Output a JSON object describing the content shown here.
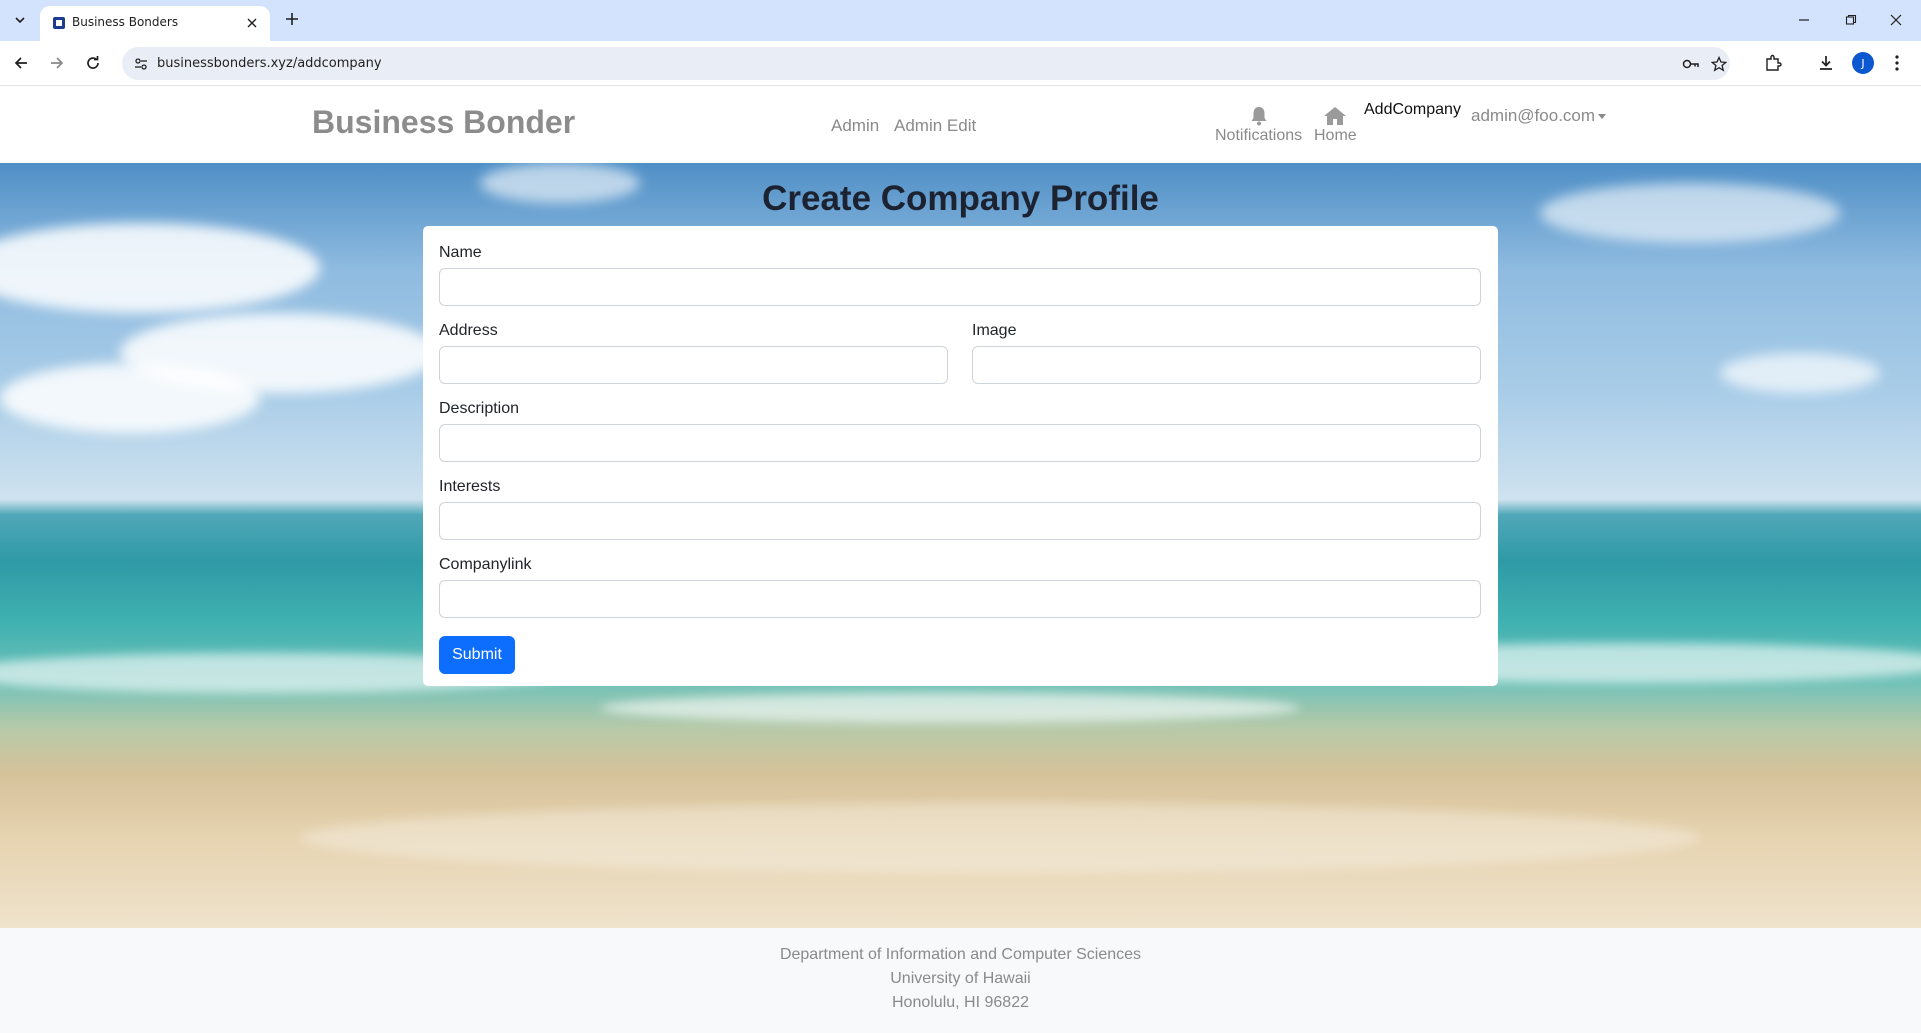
{
  "browser": {
    "tab_title": "Business Bonders",
    "url": "businessbonders.xyz/addcompany",
    "profile_initial": "J"
  },
  "nav": {
    "brand": "Business Bonder",
    "links": [
      "Admin",
      "Admin Edit"
    ],
    "notifications_label": "Notifications",
    "home_label": "Home",
    "active_label": "AddCompany",
    "user_email": "admin@foo.com"
  },
  "form": {
    "title": "Create Company Profile",
    "fields": {
      "name": {
        "label": "Name",
        "value": ""
      },
      "address": {
        "label": "Address",
        "value": ""
      },
      "image": {
        "label": "Image",
        "value": ""
      },
      "description": {
        "label": "Description",
        "value": ""
      },
      "interests": {
        "label": "Interests",
        "value": ""
      },
      "companylink": {
        "label": "Companylink",
        "value": ""
      }
    },
    "submit_label": "Submit"
  },
  "footer": {
    "line1": "Department of Information and Computer Sciences",
    "line2": "University of Hawaii",
    "line3": "Honolulu, HI 96822"
  },
  "colors": {
    "primary": "#0d6efd",
    "tabstrip": "#d3e3fd"
  },
  "icons": [
    "tab-list-icon",
    "favicon-icon",
    "close-icon",
    "plus-icon",
    "minimize-icon",
    "restore-icon",
    "window-close-icon",
    "back-icon",
    "forward-icon",
    "reload-icon",
    "site-info-icon",
    "password-key-icon",
    "star-icon",
    "extensions-icon",
    "download-icon",
    "more-icon",
    "bell-icon",
    "home-icon"
  ]
}
